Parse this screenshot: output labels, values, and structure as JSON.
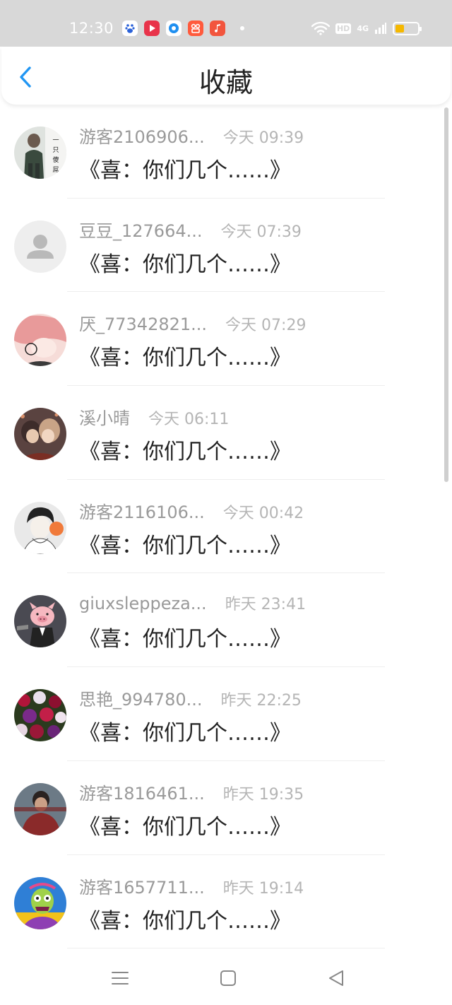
{
  "status_bar": {
    "time": "12:30",
    "network": "4G",
    "hd": "HD",
    "battery_level": 0.4,
    "apps": [
      {
        "icon": "baidu-icon",
        "color": "#ffffff"
      },
      {
        "icon": "video-play-icon",
        "color": "#e8334a"
      },
      {
        "icon": "browser-icon",
        "color": "#1f8ff0"
      },
      {
        "icon": "kuaishou-icon",
        "color": "#ff5a3c"
      },
      {
        "icon": "music-icon",
        "color": "#f2553d"
      }
    ]
  },
  "header": {
    "title": "收藏",
    "back_icon": "chevron-left-icon",
    "accent_color": "#2196f3"
  },
  "items": [
    {
      "username": "游客2106906...",
      "time": "今天 09:39",
      "message": "《喜：你们几个……》",
      "avatar": "photo-man-avatar"
    },
    {
      "username": "豆豆_127664...",
      "time": "今天 07:39",
      "message": "《喜：你们几个……》",
      "avatar": "default-user-avatar"
    },
    {
      "username": "厌_77342821...",
      "time": "今天 07:29",
      "message": "《喜：你们几个……》",
      "avatar": "anime-pink-hair-avatar"
    },
    {
      "username": "溪小晴",
      "time": "今天 06:11",
      "message": "《喜：你们几个……》",
      "avatar": "anime-couple-avatar"
    },
    {
      "username": "游客2116106...",
      "time": "今天 00:42",
      "message": "《喜：你们几个……》",
      "avatar": "sketch-boy-avatar"
    },
    {
      "username": "giuxsleppeza...",
      "time": "昨天 23:41",
      "message": "《喜：你们几个……》",
      "avatar": "pig-avatar"
    },
    {
      "username": "思艳_994780...",
      "time": "昨天 22:25",
      "message": "《喜：你们几个……》",
      "avatar": "flowers-avatar"
    },
    {
      "username": "游客1816461...",
      "time": "昨天 19:35",
      "message": "《喜：你们几个……》",
      "avatar": "photo-boy-avatar"
    },
    {
      "username": "游客1657711...",
      "time": "昨天 19:14",
      "message": "《喜：你们几个……》",
      "avatar": "cartoon-zombie-avatar"
    }
  ],
  "nav": {
    "menu_icon": "menu-icon",
    "home_icon": "home-square-icon",
    "back_icon": "back-triangle-icon"
  }
}
